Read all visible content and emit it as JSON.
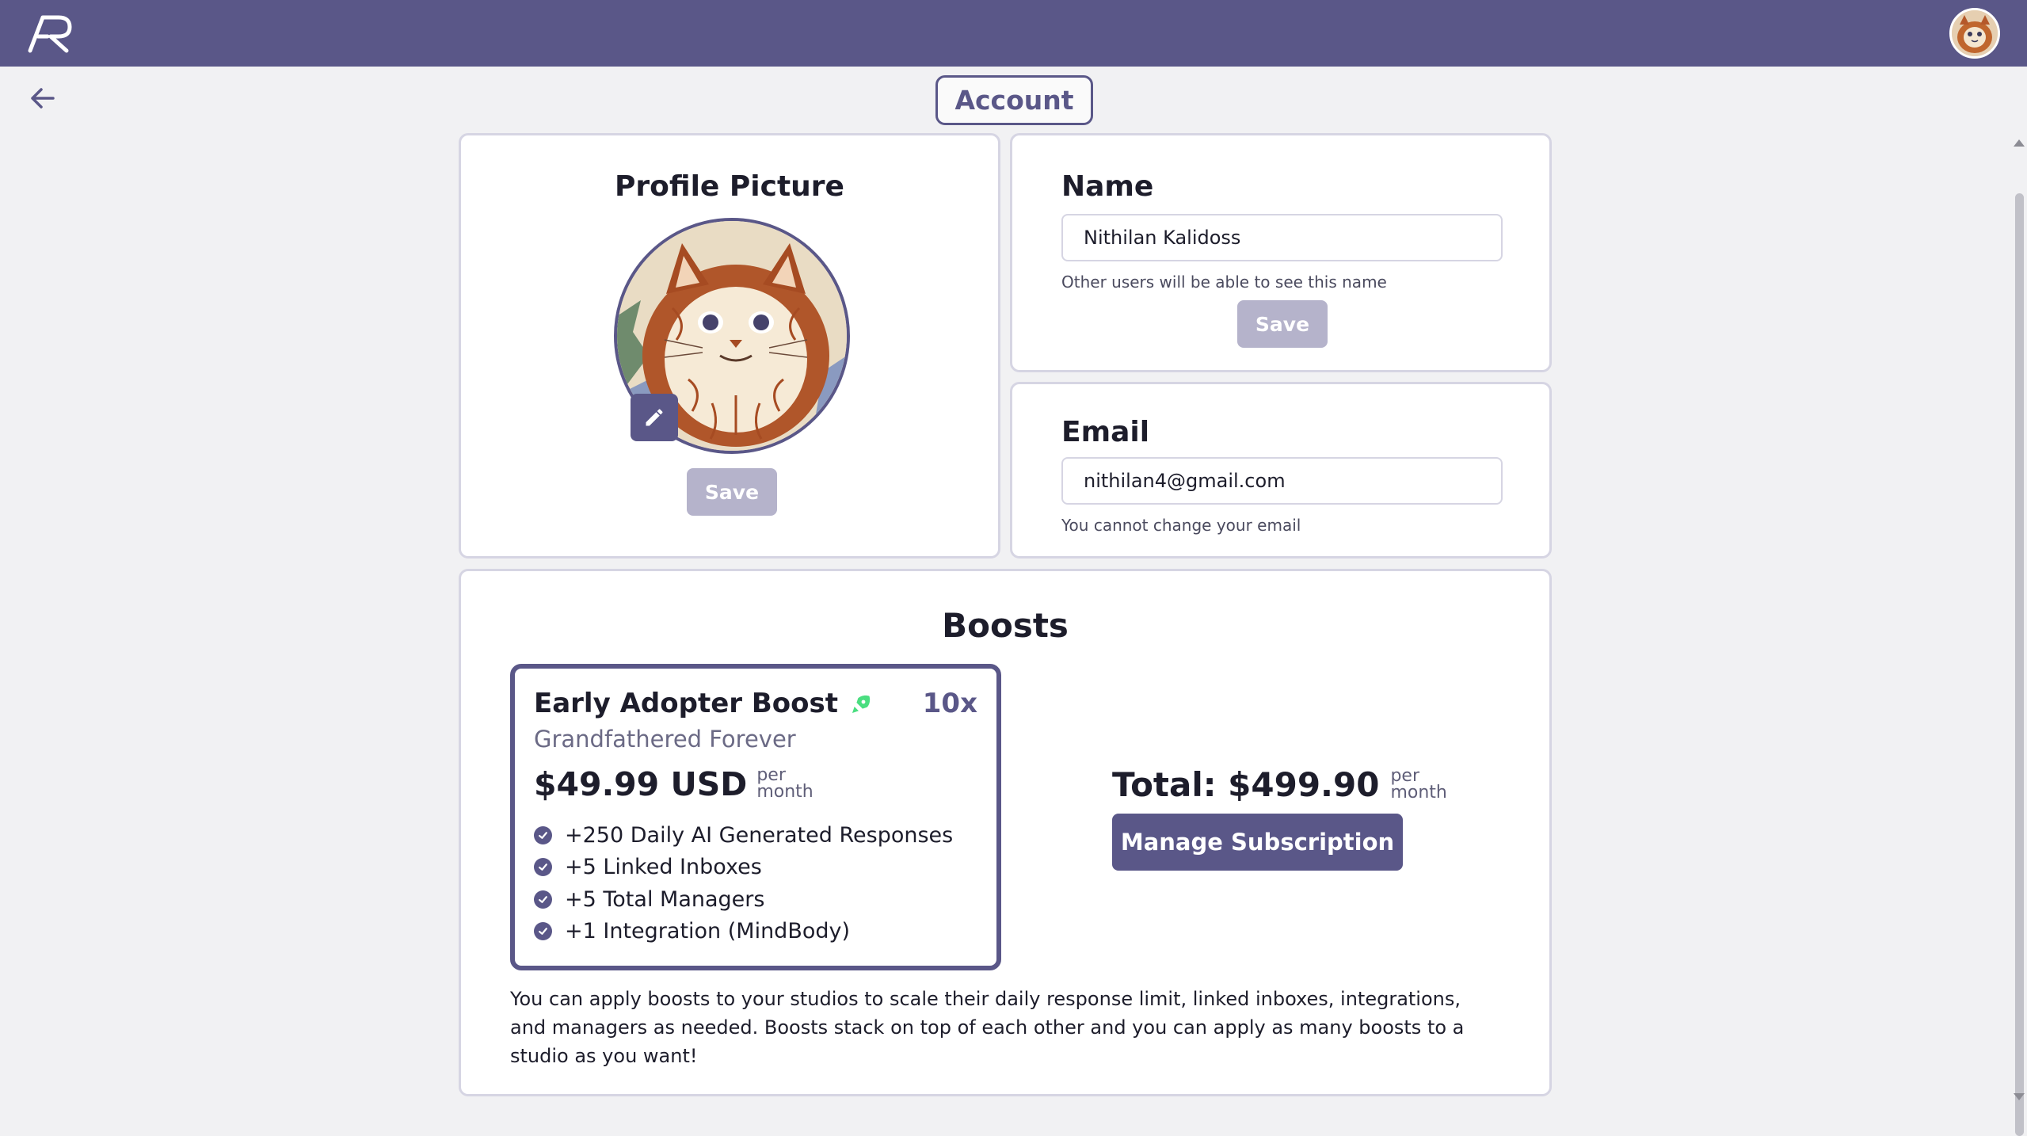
{
  "header": {
    "logo_icon": "ar-logo-icon",
    "avatar_icon": "user-avatar"
  },
  "nav": {
    "back_icon": "arrow-left-icon"
  },
  "page": {
    "title": "Account"
  },
  "profile": {
    "title": "Profile Picture",
    "edit_icon": "pencil-icon",
    "save_label": "Save"
  },
  "name_section": {
    "title": "Name",
    "value": "Nithilan Kalidoss",
    "hint": "Other users will be able to see this name",
    "save_label": "Save"
  },
  "email_section": {
    "title": "Email",
    "value": "nithilan4@gmail.com",
    "hint": "You cannot change your email"
  },
  "boosts": {
    "title": "Boosts",
    "tile": {
      "name": "Early Adopter Boost",
      "icon": "rocket-icon",
      "multiplier": "10x",
      "subtitle": "Grandfathered Forever",
      "price": "$49.99 USD",
      "per": "per",
      "month": "month",
      "features": [
        "+250 Daily AI Generated Responses",
        "+5 Linked Inboxes",
        "+5 Total Managers",
        "+1 Integration (MindBody)"
      ]
    },
    "total": "Total: $499.90",
    "total_per": "per",
    "total_month": "month",
    "manage_label": "Manage Subscription",
    "description": "You can apply boosts to your studios to scale their daily response limit, linked inboxes, integrations, and managers as needed. Boosts stack on top of each other and you can apply as many boosts to a studio as you want!"
  },
  "colors": {
    "brand": "#5a5788",
    "disabled": "#b5b3cb",
    "rocket": "#4ade80"
  }
}
